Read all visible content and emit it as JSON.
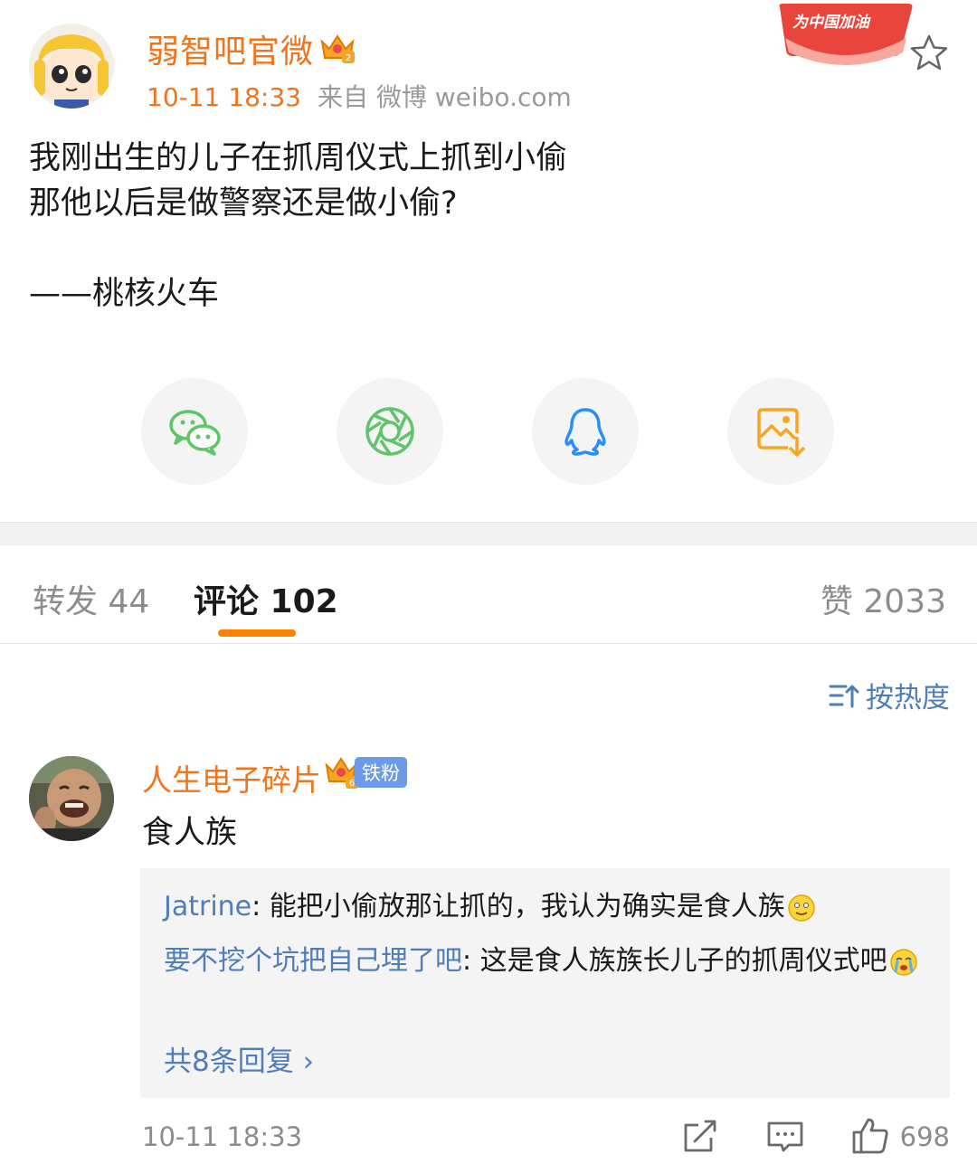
{
  "post": {
    "author": "弱智吧官微",
    "time": "10-11 18:33",
    "source": "来自 微博 weibo.com",
    "cheer_badge": "为中国加油",
    "lines": [
      "我刚出生的儿子在抓周仪式上抓到小偷",
      "那他以后是做警察还是做小偷?"
    ],
    "signature": "——桃核火车"
  },
  "share": [
    {
      "name": "wechat-icon",
      "color": "#5fc46a"
    },
    {
      "name": "moments-icon",
      "color": "#5fc46a"
    },
    {
      "name": "qq-icon",
      "color": "#2b8ef5"
    },
    {
      "name": "save-image-icon",
      "color": "#f5a623"
    }
  ],
  "tabs": {
    "repost": "转发 44",
    "comment": "评论 102",
    "like": "赞 2033"
  },
  "sort": {
    "label": "按热度"
  },
  "comment": {
    "user": "人生电子碎片",
    "fan_badge": "铁粉",
    "text": "食人族",
    "replies": [
      {
        "user": "Jatrine",
        "text": ": 能把小偷放那让抓的，我认为确实是食人族"
      },
      {
        "user": "要不挖个坑把自己埋了吧",
        "text": ": 这是食人族族长儿子的抓周仪式吧"
      }
    ],
    "more_replies": "共8条回复 ›",
    "time": "10-11 18:33",
    "likes": "698"
  }
}
